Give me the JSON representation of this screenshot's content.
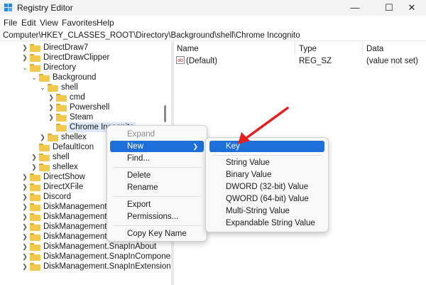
{
  "window": {
    "title": "Registry Editor",
    "minimize_icon": "minimize-icon",
    "maximize_icon": "maximize-icon",
    "close_icon": "close-icon"
  },
  "menu": {
    "items": [
      "File",
      "Edit",
      "View",
      "Favorites",
      "Help"
    ]
  },
  "address": {
    "path": "Computer\\HKEY_CLASSES_ROOT\\Directory\\Background\\shell\\Chrome Incognito"
  },
  "tree": {
    "nodes": [
      {
        "label": "DirectDraw7",
        "expanded": false
      },
      {
        "label": "DirectDrawClipper",
        "expanded": false
      },
      {
        "label": "Directory",
        "expanded": true
      },
      {
        "label": "Background",
        "expanded": true
      },
      {
        "label": "shell",
        "expanded": true
      },
      {
        "label": "cmd",
        "expanded": false
      },
      {
        "label": "Powershell",
        "expanded": false
      },
      {
        "label": "Steam",
        "expanded": false
      },
      {
        "label": "Chrome Incognito",
        "selected": true
      },
      {
        "label": "shellex",
        "expanded": false
      },
      {
        "label": "DefaultIcon"
      },
      {
        "label": "shell",
        "expanded": false
      },
      {
        "label": "shellex",
        "expanded": false
      },
      {
        "label": "DirectShow",
        "expanded": false
      },
      {
        "label": "DirectXFile",
        "expanded": false
      },
      {
        "label": "Discord",
        "expanded": false
      },
      {
        "label": "DiskManagement.Connection",
        "expanded": false
      },
      {
        "label": "DiskManagement.Control",
        "expanded": false
      },
      {
        "label": "DiskManagement.DataObject",
        "expanded": false
      },
      {
        "label": "DiskManagement.SnapIn",
        "expanded": false
      },
      {
        "label": "DiskManagement.SnapInAbout",
        "expanded": false
      },
      {
        "label": "DiskManagement.SnapInComponent",
        "expanded": false
      },
      {
        "label": "DiskManagement.SnapInExtension",
        "expanded": false
      }
    ]
  },
  "values_pane": {
    "columns": [
      "Name",
      "Type",
      "Data"
    ],
    "rows": [
      {
        "name": "(Default)",
        "type": "REG_SZ",
        "data": "(value not set)"
      }
    ]
  },
  "context_menu": {
    "items": [
      "Expand",
      "New",
      "Find...",
      "Delete",
      "Rename",
      "Export",
      "Permissions...",
      "Copy Key Name"
    ]
  },
  "submenu": {
    "items": [
      "Key",
      "String Value",
      "Binary Value",
      "DWORD (32-bit) Value",
      "QWORD (64-bit) Value",
      "Multi-String Value",
      "Expandable String Value"
    ]
  },
  "colors": {
    "accent": "#1e6fd9",
    "folder": "#f2c94c",
    "annotation_arrow": "#e02020"
  }
}
